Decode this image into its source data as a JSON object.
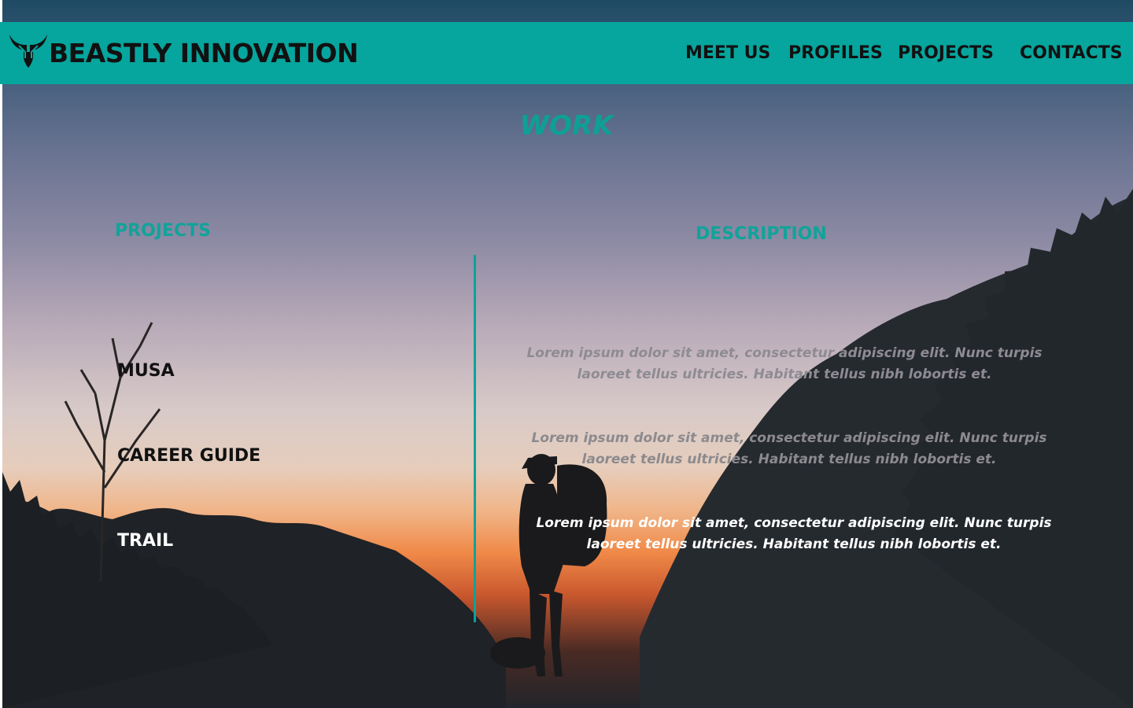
{
  "header": {
    "brand": "BEASTLY INNOVATION",
    "logo_icon": "bull-horns-icon",
    "nav": [
      "MEET US",
      "PROFILES",
      "PROJECTS",
      "CONTACTS"
    ],
    "color": "#06a59d"
  },
  "section": {
    "title": "WORK",
    "projects_heading": "PROJECTS",
    "description_heading": "DESCRIPTION",
    "accent_color": "#0e9f96"
  },
  "projects": [
    {
      "name": "MUSA",
      "description": "Lorem ipsum dolor sit amet, consectetur adipiscing elit. Nunc turpis laoreet tellus ultricies. Habitant tellus nibh lobortis et."
    },
    {
      "name": "CAREER GUIDE",
      "description": "Lorem ipsum dolor sit amet, consectetur adipiscing elit. Nunc turpis laoreet tellus ultricies. Habitant tellus nibh lobortis et."
    },
    {
      "name": "TRAIL",
      "description": "Lorem ipsum dolor sit amet, consectetur adipiscing elit. Nunc turpis laoreet tellus ultricies. Habitant tellus nibh lobortis et."
    }
  ]
}
